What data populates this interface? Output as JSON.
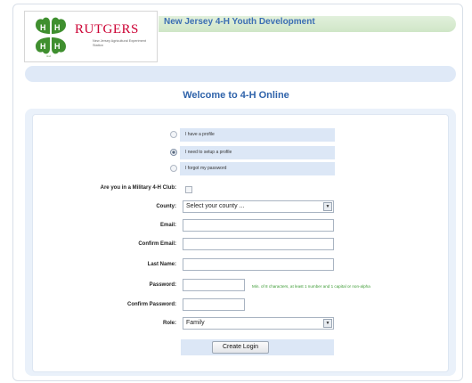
{
  "header": {
    "brand_name": "RUTGERS",
    "brand_subtitle": "New Jersey Agricultural Experiment Station",
    "clover_caption": "4-H",
    "title": "New Jersey 4-H Youth Development"
  },
  "page": {
    "welcome": "Welcome to 4-H Online"
  },
  "profile_options": [
    {
      "label": "I have a profile",
      "checked": false
    },
    {
      "label": "I need to setup a profile",
      "checked": true
    },
    {
      "label": "I forgot my password",
      "checked": false
    }
  ],
  "form": {
    "military_label": "Are you in a Military 4-H Club:",
    "county_label": "County:",
    "county_value": "Select your county ...",
    "email_label": "Email:",
    "confirm_email_label": "Confirm Email:",
    "last_name_label": "Last Name:",
    "password_label": "Password:",
    "password_hint": "Min. of 8 characters, at least 1 number and 1 capital or non-alpha",
    "confirm_password_label": "Confirm Password:",
    "role_label": "Role:",
    "role_value": "Family",
    "submit_label": "Create Login"
  },
  "colors": {
    "brand_red": "#cc0033",
    "clover_green": "#3f8f2f",
    "title_blue": "#2f63aa",
    "hint_green": "#3a9a32"
  }
}
